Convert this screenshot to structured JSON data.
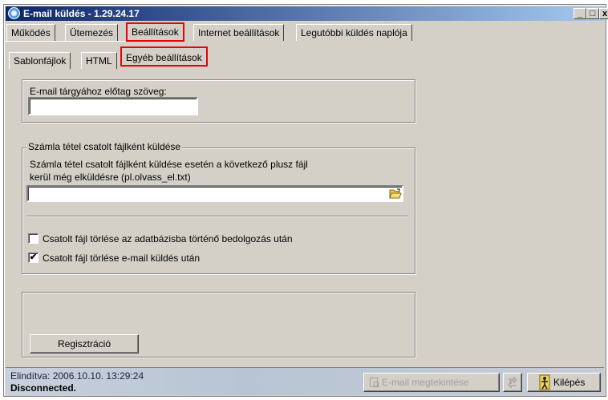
{
  "window": {
    "title": "E-mail küldés  -  1.29.24.17",
    "controls": {
      "minimize": "_",
      "maximize": "□",
      "close": "x"
    }
  },
  "main_tabs": [
    {
      "label": "Működés"
    },
    {
      "label": "Ütemezés"
    },
    {
      "label": "Beállítások",
      "selected": true
    },
    {
      "label": "Internet beállítások"
    },
    {
      "label": "Legutóbbi küldés naplója"
    }
  ],
  "sub_tabs": [
    {
      "label": "Sablonfájlok"
    },
    {
      "label": "HTML"
    },
    {
      "label": "Egyéb beállítások",
      "selected": true
    }
  ],
  "subject_group": {
    "label": "E-mail tárgyához előtag szöveg:",
    "value": ""
  },
  "attachment_group": {
    "legend": "Számla tétel csatolt fájlként küldése",
    "description_line1": "Számla tétel csatolt fájlként küldése esetén a következő plusz fájl",
    "description_line2": "kerül még elküldésre   (pl.olvass_el.txt)",
    "file_value": "",
    "checkbox1_label": "Csatolt fájl törlése az adatbázisba történő bedolgozás után",
    "checkbox1_checked": false,
    "checkbox2_label": "Csatolt fájl törlése e-mail küldés után",
    "checkbox2_checked": true
  },
  "register_button": "Regisztráció",
  "status": {
    "started": "Elindítva: 2006.10.10. 13:29:24",
    "connection": "Disconnected."
  },
  "bottom_buttons": {
    "view_email": "E-mail megtekintése",
    "exit": "Kilépés"
  },
  "colors": {
    "highlight_border": "#e8000b",
    "titlebar_start": "#0a246a",
    "face": "#d4d0c8"
  }
}
